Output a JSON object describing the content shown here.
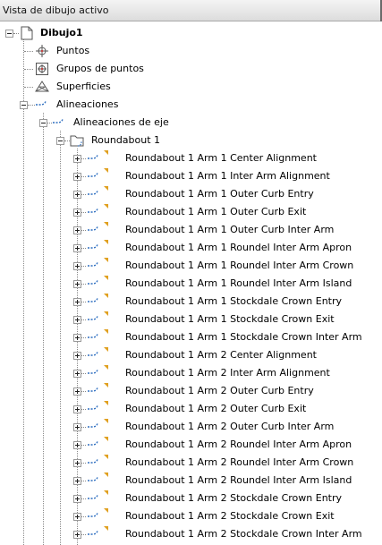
{
  "header": {
    "title": "Vista de dibujo activo"
  },
  "tree": {
    "root": {
      "label": "Dibujo1"
    },
    "puntos": {
      "label": "Puntos"
    },
    "grupos_puntos": {
      "label": "Grupos de puntos"
    },
    "superficies": {
      "label": "Superficies"
    },
    "alineaciones": {
      "label": "Alineaciones"
    },
    "alineaciones_eje": {
      "label": "Alineaciones de eje"
    },
    "roundabout": {
      "label": "Roundabout 1"
    },
    "alignments": [
      "Roundabout 1 Arm 1 Center Alignment",
      "Roundabout 1 Arm 1 Inter Arm Alignment",
      "Roundabout 1 Arm 1 Outer Curb Entry",
      "Roundabout 1 Arm 1 Outer Curb Exit",
      "Roundabout 1 Arm 1 Outer Curb Inter Arm",
      "Roundabout 1 Arm 1 Roundel Inter Arm Apron",
      "Roundabout 1 Arm 1 Roundel Inter Arm Crown",
      "Roundabout 1 Arm 1 Roundel Inter Arm Island",
      "Roundabout 1 Arm 1 Stockdale Crown Entry",
      "Roundabout 1 Arm 1 Stockdale Crown Exit",
      "Roundabout 1 Arm 1 Stockdale Crown Inter Arm",
      "Roundabout 1 Arm 2 Center Alignment",
      "Roundabout 1 Arm 2 Inter Arm Alignment",
      "Roundabout 1 Arm 2 Outer Curb Entry",
      "Roundabout 1 Arm 2 Outer Curb Exit",
      "Roundabout 1 Arm 2 Outer Curb Inter Arm",
      "Roundabout 1 Arm 2 Roundel Inter Arm Apron",
      "Roundabout 1 Arm 2 Roundel Inter Arm Crown",
      "Roundabout 1 Arm 2 Roundel Inter Arm Island",
      "Roundabout 1 Arm 2 Stockdale Crown Entry",
      "Roundabout 1 Arm 2 Stockdale Crown Exit",
      "Roundabout 1 Arm 2 Stockdale Crown Inter Arm"
    ]
  },
  "icons": {
    "root": "drawing-icon",
    "puntos": "point-icon",
    "grupos_puntos": "point-group-icon",
    "superficies": "surface-icon",
    "alineaciones": "alignment-icon",
    "alineaciones_eje": "alignment-icon",
    "roundabout": "folder-icon",
    "alignment_item": "alignment-icon"
  },
  "colors": {
    "alignment_blue": "#2f6fc0",
    "flag_orange": "#e0a020",
    "tree_line": "#8a8a8a"
  }
}
